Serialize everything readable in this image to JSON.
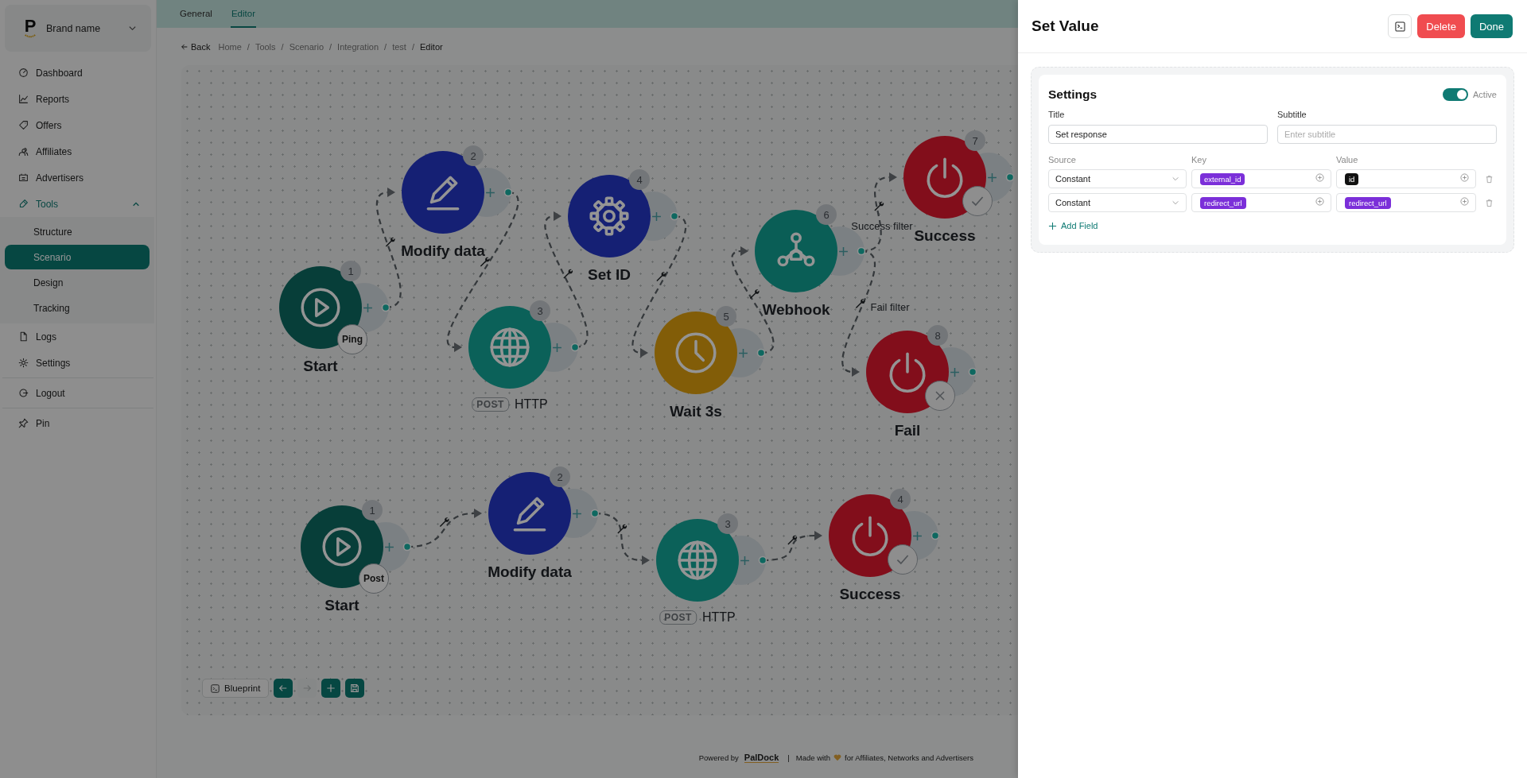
{
  "sidebar": {
    "brand": {
      "logo_letter": "P",
      "name": "Brand name"
    },
    "groups": [
      [
        {
          "kind": "dashboard",
          "label": "Dashboard",
          "selected": false
        },
        {
          "kind": "reports",
          "label": "Reports",
          "selected": false
        },
        {
          "kind": "offers",
          "label": "Offers",
          "selected": false
        },
        {
          "kind": "affiliates",
          "label": "Affiliates",
          "selected": false
        },
        {
          "kind": "advertisers",
          "label": "Advertisers",
          "selected": false
        },
        {
          "kind": "tools",
          "label": "Tools",
          "selected": false,
          "expanded": true,
          "children": [
            {
              "label": "Structure",
              "selected": false
            },
            {
              "label": "Scenario",
              "selected": true
            },
            {
              "label": "Design",
              "selected": false
            },
            {
              "label": "Tracking",
              "selected": false
            }
          ]
        },
        {
          "kind": "logs",
          "label": "Logs",
          "selected": false
        },
        {
          "kind": "settings",
          "label": "Settings",
          "selected": false
        }
      ],
      [
        {
          "kind": "logout",
          "label": "Logout",
          "selected": false
        }
      ],
      [
        {
          "kind": "pin",
          "label": "Pin",
          "selected": false
        }
      ]
    ]
  },
  "tabs": [
    {
      "label": "General",
      "selected": false
    },
    {
      "label": "Editor",
      "selected": true
    }
  ],
  "breadcrumb": {
    "back": "Back",
    "separator": "/",
    "items": [
      "Home",
      "Tools",
      "Scenario",
      "Integration",
      "test",
      "Editor"
    ]
  },
  "flows": [
    {
      "nodes": [
        {
          "number": "1",
          "kind": "start",
          "label": "Start",
          "trigger": "Ping"
        },
        {
          "number": "2",
          "kind": "edit",
          "label": "Modify data"
        },
        {
          "number": "3",
          "kind": "http",
          "label": "HTTP",
          "method": "POST"
        },
        {
          "number": "4",
          "kind": "settings",
          "label": "Set ID"
        },
        {
          "number": "5",
          "kind": "wait",
          "label": "Wait 3s"
        },
        {
          "number": "6",
          "kind": "webhook",
          "label": "Webhook"
        },
        {
          "number": "7",
          "kind": "end",
          "label": "Success",
          "succeeded": true,
          "filter": "Success filter"
        },
        {
          "number": "8",
          "kind": "end",
          "label": "Fail",
          "succeeded": false,
          "filter": "Fail filter"
        }
      ]
    },
    {
      "nodes": [
        {
          "number": "1",
          "kind": "start",
          "label": "Start",
          "trigger": "Post"
        },
        {
          "number": "2",
          "kind": "edit",
          "label": "Modify data"
        },
        {
          "number": "3",
          "kind": "http",
          "label": "HTTP",
          "method": "POST"
        },
        {
          "number": "4",
          "kind": "end",
          "label": "Success",
          "succeeded": true
        }
      ]
    }
  ],
  "canvas_toolbar": {
    "blueprint": "Blueprint",
    "buttons": [
      {
        "kind": "undo",
        "disabled": false
      },
      {
        "kind": "redo",
        "disabled": true
      },
      {
        "kind": "add",
        "disabled": false
      },
      {
        "kind": "save",
        "disabled": false
      }
    ]
  },
  "footer": {
    "powered_by": "Powered by",
    "brand": "PalDock",
    "separator": "|",
    "made_with": "Made with",
    "audience": "for Affiliates, Networks and Advertisers"
  },
  "panel": {
    "title": "Set Value",
    "buttons": [
      {
        "kind": "console"
      },
      {
        "kind": "delete",
        "label": "Delete"
      },
      {
        "kind": "done",
        "label": "Done"
      }
    ],
    "settings": {
      "heading": "Settings",
      "active": {
        "on": true,
        "label": "Active"
      },
      "title": {
        "label": "Title",
        "value": "Set response"
      },
      "subtitle": {
        "label": "Subtitle",
        "placeholder": "Enter subtitle"
      },
      "columns": [
        "Source",
        "Key",
        "Value"
      ],
      "rows": [
        {
          "source": "Constant",
          "key": {
            "text": "external_id",
            "color": "#7b2fd9"
          },
          "value": {
            "text": "id",
            "color": "#111111"
          }
        },
        {
          "source": "Constant",
          "key": {
            "text": "redirect_url",
            "color": "#7b2fd9"
          },
          "value": {
            "text": "redirect_url",
            "color": "#7b2fd9"
          }
        }
      ],
      "add_field": "Add Field"
    }
  }
}
